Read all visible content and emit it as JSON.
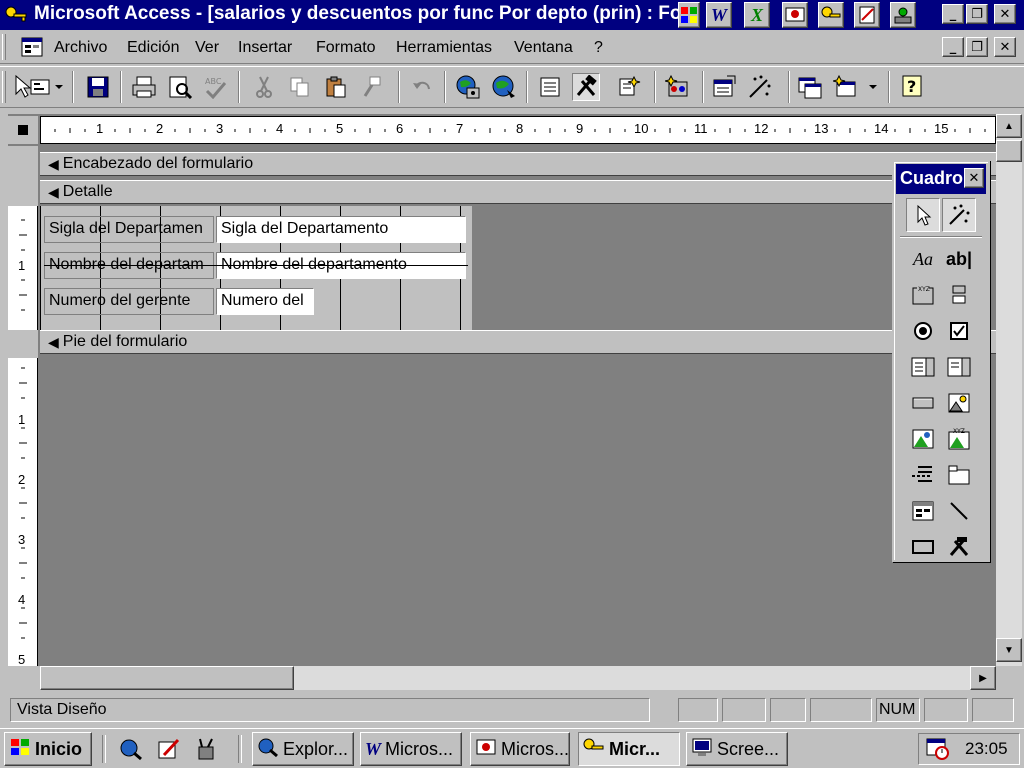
{
  "window": {
    "title": "Microsoft Access - [salarios y descuentos por func Por depto (prin) : Fo"
  },
  "menu": {
    "items": [
      "Archivo",
      "Edición",
      "Ver",
      "Insertar",
      "Formato",
      "Herramientas",
      "Ventana",
      "?"
    ]
  },
  "ruler": {
    "h_ticks": [
      "1",
      "2",
      "3",
      "4",
      "5",
      "6",
      "7",
      "8",
      "9",
      "10",
      "11",
      "12",
      "13",
      "14",
      "15"
    ],
    "v_ticks": [
      "1",
      "2",
      "3",
      "4",
      "5"
    ]
  },
  "sections": {
    "header": "Encabezado del formulario",
    "detail": "Detalle",
    "footer": "Pie del formulario"
  },
  "fields": [
    {
      "label": "Sigla del Departamen",
      "value": "Sigla del Departamento"
    },
    {
      "label": "Nombre del departam",
      "value": "Nombre del departamento"
    },
    {
      "label": "Numero del gerente",
      "value": "Numero del"
    }
  ],
  "toolbox": {
    "title": "Cuadro",
    "tools": [
      "Aa",
      "ab|"
    ]
  },
  "status": {
    "text": "Vista Diseño",
    "num": "NUM"
  },
  "taskbar": {
    "start": "Inicio",
    "tasks": [
      "Explor...",
      "Micros...",
      "Micros...",
      "Micr...",
      "Scree..."
    ],
    "clock": "23:05"
  },
  "colors": {
    "titlebar": "#000080",
    "face": "#c0c0c0",
    "design_bg": "#808080"
  }
}
